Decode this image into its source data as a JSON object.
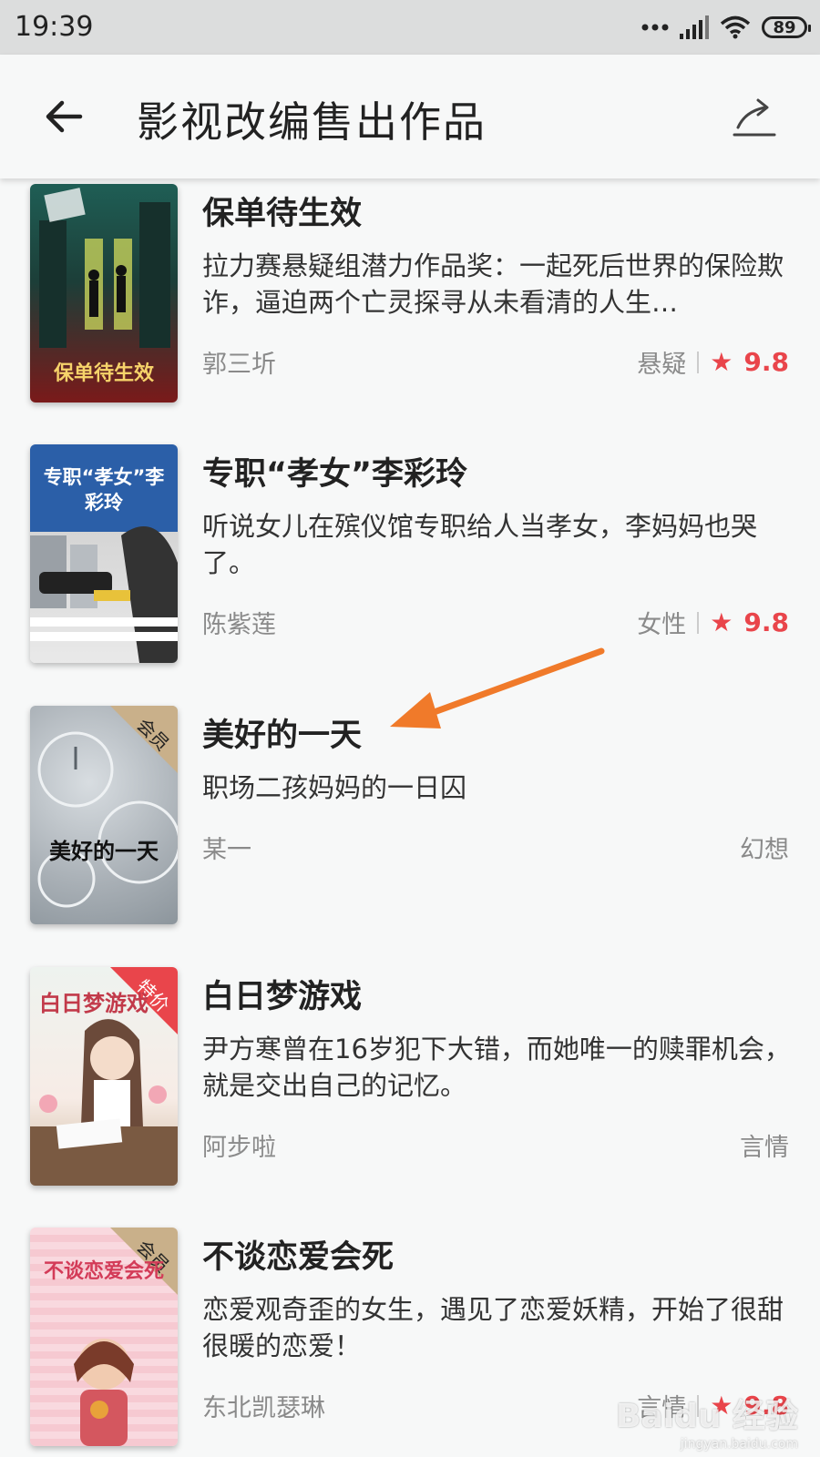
{
  "status_bar": {
    "time": "19:39",
    "battery": "89"
  },
  "header": {
    "title": "影视改编售出作品"
  },
  "books": [
    {
      "title": "保单待生效",
      "desc": "拉力赛悬疑组潜力作品奖：一起死后世界的保险欺诈，逼迫两个亡灵探寻从未看清的人生…",
      "author": "郭三圻",
      "genre": "悬疑",
      "rating": "9.8",
      "cover_title": "保单待生效"
    },
    {
      "title": "专职“孝女”李彩玲",
      "desc": "听说女儿在殡仪馆专职给人当孝女，李妈妈也哭了。",
      "author": "陈紫莲",
      "genre": "女性",
      "rating": "9.8",
      "cover_title": "专职“孝女”李彩玲"
    },
    {
      "title": "美好的一天",
      "desc": "职场二孩妈妈的一日囚",
      "author": "某一",
      "genre": "幻想",
      "badge": "会员",
      "cover_title": "美好的一天"
    },
    {
      "title": "白日梦游戏",
      "desc": "尹方寒曾在16岁犯下大错，而她唯一的赎罪机会，就是交出自己的记忆。",
      "author": "阿步啦",
      "genre": "言情",
      "badge": "特价",
      "cover_title": "白日梦游戏"
    },
    {
      "title": "不谈恋爱会死",
      "desc": "恋爱观奇歪的女生，遇见了恋爱妖精，开始了很甜很暖的恋爱！",
      "author": "东北凯瑟琳",
      "genre": "言情",
      "rating": "9.8",
      "badge": "会员",
      "cover_title": "不谈恋爱会死"
    }
  ],
  "watermark": {
    "main": "Baidu 经验",
    "sub": "jingyan.baidu.com"
  },
  "colors": {
    "accent": "#e9454b",
    "arrow": "#f07a2a"
  }
}
